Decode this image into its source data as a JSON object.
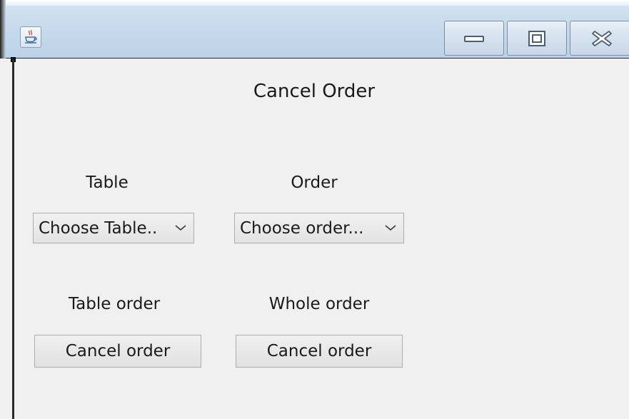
{
  "window": {
    "app_icon": "java-cup-icon",
    "controls": {
      "minimize_icon": "minimize-icon",
      "maximize_icon": "maximize-icon",
      "close_icon": "close-icon"
    },
    "accent_color": "#bcd2e8"
  },
  "main": {
    "heading": "Cancel Order",
    "table_section": {
      "label": "Table",
      "select_value": "Choose Table..",
      "select_icon": "chevron-down-icon"
    },
    "order_section": {
      "label": "Order",
      "select_value": "Choose order...",
      "select_icon": "chevron-down-icon"
    },
    "table_order_section": {
      "label": "Table order",
      "button_label": "Cancel order"
    },
    "whole_order_section": {
      "label": "Whole order",
      "button_label": "Cancel order"
    }
  }
}
